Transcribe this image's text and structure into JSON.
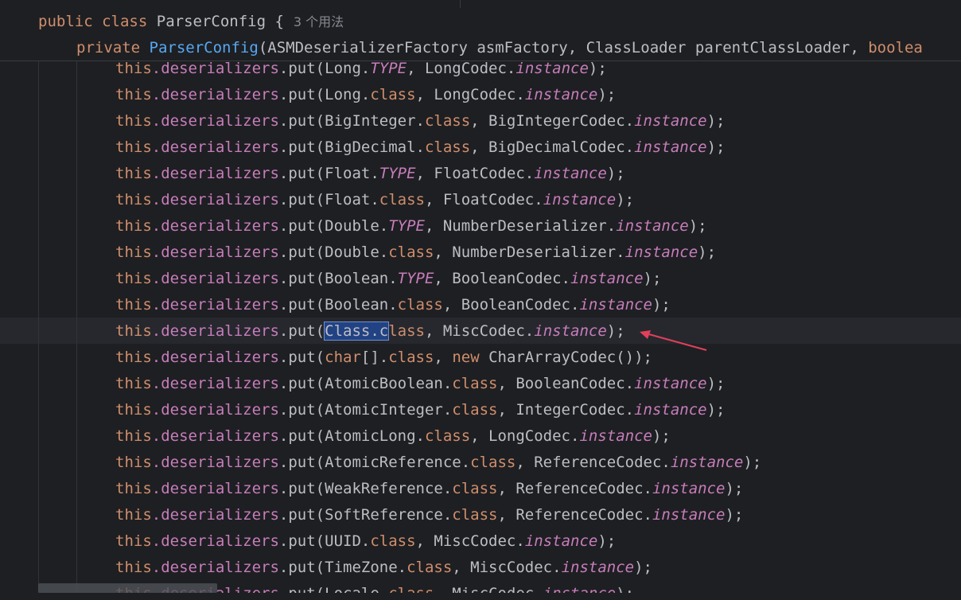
{
  "sticky_header": {
    "line1": {
      "kw1": "public",
      "kw2": "class",
      "name": "ParserConfig {",
      "usage_hint": "3 个用法"
    },
    "line2": {
      "kw": "private",
      "method": "ParserConfig",
      "params": "(ASMDeserializerFactory asmFactory, ClassLoader parentClassLoader, ",
      "trailing_kw": "boolea"
    }
  },
  "code": {
    "prefix_kw": "this",
    "prefix_field": ".deserializers",
    "prefix_method": ".put(",
    "lines": [
      {
        "key": "Long.",
        "key_kw": "TYPE",
        "key_kw_italic": true,
        "val": ", LongCodec.",
        "val_field": "instance",
        "end": ");"
      },
      {
        "key": "Long.",
        "key_kw": "class",
        "key_kw_italic": false,
        "val": ", LongCodec.",
        "val_field": "instance",
        "end": ");"
      },
      {
        "key": "BigInteger.",
        "key_kw": "class",
        "key_kw_italic": false,
        "val": ", BigIntegerCodec.",
        "val_field": "instance",
        "end": ");"
      },
      {
        "key": "BigDecimal.",
        "key_kw": "class",
        "key_kw_italic": false,
        "val": ", BigDecimalCodec.",
        "val_field": "instance",
        "end": ");"
      },
      {
        "key": "Float.",
        "key_kw": "TYPE",
        "key_kw_italic": true,
        "val": ", FloatCodec.",
        "val_field": "instance",
        "end": ");"
      },
      {
        "key": "Float.",
        "key_kw": "class",
        "key_kw_italic": false,
        "val": ", FloatCodec.",
        "val_field": "instance",
        "end": ");"
      },
      {
        "key": "Double.",
        "key_kw": "TYPE",
        "key_kw_italic": true,
        "val": ", NumberDeserializer.",
        "val_field": "instance",
        "end": ");"
      },
      {
        "key": "Double.",
        "key_kw": "class",
        "key_kw_italic": false,
        "val": ", NumberDeserializer.",
        "val_field": "instance",
        "end": ");"
      },
      {
        "key": "Boolean.",
        "key_kw": "TYPE",
        "key_kw_italic": true,
        "val": ", BooleanCodec.",
        "val_field": "instance",
        "end": ");"
      },
      {
        "key": "Boolean.",
        "key_kw": "class",
        "key_kw_italic": false,
        "val": ", BooleanCodec.",
        "val_field": "instance",
        "end": ");"
      },
      {
        "selected": true,
        "sel_text": "Class.c",
        "rest_kw": "lass",
        "val": ", MiscCodec.",
        "val_field": "instance",
        "end": ");"
      },
      {
        "special": "char",
        "key": "char",
        "key2": "[].",
        "key_kw": "class",
        "val": ", ",
        "new_kw": "new",
        "tail": " CharArrayCodec());"
      },
      {
        "key": "AtomicBoolean.",
        "key_kw": "class",
        "key_kw_italic": false,
        "val": ", BooleanCodec.",
        "val_field": "instance",
        "end": ");"
      },
      {
        "key": "AtomicInteger.",
        "key_kw": "class",
        "key_kw_italic": false,
        "val": ", IntegerCodec.",
        "val_field": "instance",
        "end": ");"
      },
      {
        "key": "AtomicLong.",
        "key_kw": "class",
        "key_kw_italic": false,
        "val": ", LongCodec.",
        "val_field": "instance",
        "end": ");"
      },
      {
        "key": "AtomicReference.",
        "key_kw": "class",
        "key_kw_italic": false,
        "val": ", ReferenceCodec.",
        "val_field": "instance",
        "end": ");"
      },
      {
        "key": "WeakReference.",
        "key_kw": "class",
        "key_kw_italic": false,
        "val": ", ReferenceCodec.",
        "val_field": "instance",
        "end": ");"
      },
      {
        "key": "SoftReference.",
        "key_kw": "class",
        "key_kw_italic": false,
        "val": ", ReferenceCodec.",
        "val_field": "instance",
        "end": ");"
      },
      {
        "key": "UUID.",
        "key_kw": "class",
        "key_kw_italic": false,
        "val": ", MiscCodec.",
        "val_field": "instance",
        "end": ");"
      },
      {
        "key": "TimeZone.",
        "key_kw": "class",
        "key_kw_italic": false,
        "val": ", MiscCodec.",
        "val_field": "instance",
        "end": ");"
      },
      {
        "key": "Locale.",
        "key_kw": "class",
        "key_kw_italic": false,
        "val": ", MiscCodec.",
        "val_field": "instance",
        "end": ");"
      }
    ]
  },
  "colors": {
    "background": "#1e1f22",
    "keyword": "#cf8e6d",
    "method_decl": "#56a8f5",
    "field": "#c77dbb",
    "selection": "#214283",
    "annotation_arrow": "#e0405a"
  }
}
